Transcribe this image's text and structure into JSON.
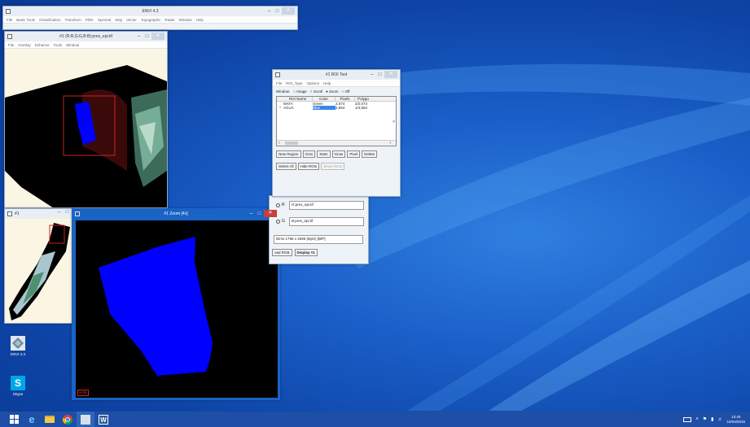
{
  "envi_main": {
    "title": "ENVI 4.3",
    "menu": [
      "File",
      "Basic Tools",
      "Classification",
      "Transform",
      "Filter",
      "Spectral",
      "Map",
      "Vector",
      "Topographic",
      "Radar",
      "Window",
      "Help"
    ]
  },
  "image_window": {
    "title": "#1 (R:R,G:G,B:B):pres_epi.tif",
    "menu": [
      "File",
      "Overlay",
      "Enhance",
      "Tools",
      "Window"
    ]
  },
  "roi_tool": {
    "title": "#1 ROI Tool",
    "menu": [
      "File",
      "ROI_Type",
      "Options",
      "Help"
    ],
    "window_label": "Window:",
    "window_options": [
      "Image",
      "Scroll",
      "Zoom",
      "Off"
    ],
    "window_selected": "Zoom",
    "table_headers": [
      "ROI Name",
      "Color",
      "Pixels",
      "Polygo"
    ],
    "rows": [
      {
        "marker": "",
        "name": "MATA",
        "color": "Green",
        "pixels": "2,074",
        "polygons": "2/2,074"
      },
      {
        "marker": "*",
        "name": "AGUA",
        "color": "Blue",
        "pixels": "4,594",
        "polygons": "1/4,594"
      }
    ],
    "buttons_row1": [
      "New Region",
      "Goto",
      "Stats",
      "Grow",
      "Pixel",
      "Delete"
    ],
    "buttons_row2": [
      "Select All",
      "Hide ROIs",
      "Show ROIs"
    ]
  },
  "band_list": {
    "radio_r_label": "R",
    "radio_g_label": "G",
    "field_r": "G:pres_epi.tif",
    "field_g": "B:pres_epi.tif",
    "dims_prefix": "Dims",
    "dims": "1796 x 2695 (Byte) [BIP]",
    "load_button": "oad RGB",
    "display_button": "Display #1"
  },
  "scroll_window": {
    "title": "#1"
  },
  "zoom_window": {
    "title": "#1 Zoom [4x]",
    "corner_tag": "+ ex"
  },
  "desktop_icons": [
    {
      "label": "ENVI 4.3",
      "icon": "envi-icon"
    },
    {
      "label": "Skype",
      "icon": "skype-icon"
    }
  ],
  "taskbar": {
    "pinned": [
      "windows-start-icon",
      "internet-explorer-icon",
      "file-explorer-icon",
      "chrome-icon",
      "envi-taskbar-icon",
      "word-icon"
    ],
    "tray": [
      "keyboard-icon",
      "chevron-up-icon",
      "flag-icon",
      "network-icon",
      "speaker-icon"
    ],
    "clock_time": "13:40",
    "clock_date": "15/04/2015"
  },
  "colors": {
    "desktop": "#1a5fc8",
    "roi_blue": "#0000ff",
    "roi_outline": "#cc2222",
    "selected_cell": "#3b86e8",
    "close_red": "#c8403a"
  }
}
